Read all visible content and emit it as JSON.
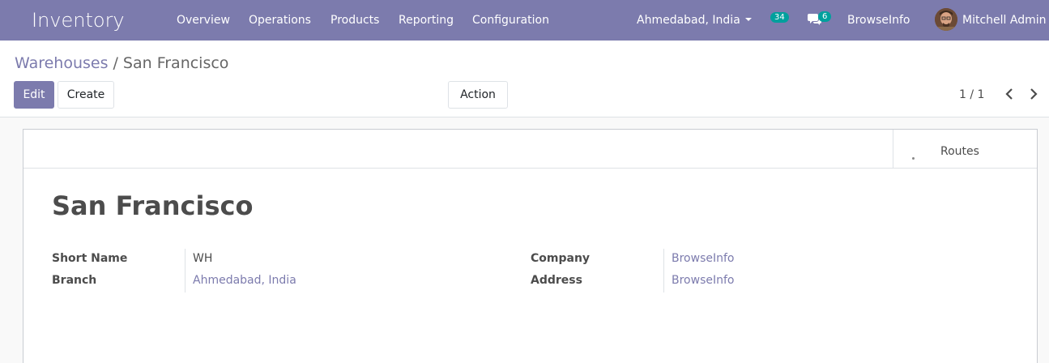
{
  "navbar": {
    "brand": "Inventory",
    "menu": [
      "Overview",
      "Operations",
      "Products",
      "Reporting",
      "Configuration"
    ],
    "branch_selector": "Ahmedabad, India",
    "activity_count": "34",
    "message_count": "6",
    "company": "BrowseInfo",
    "user": "Mitchell Admin"
  },
  "breadcrumb": {
    "parent": "Warehouses",
    "separator": "/",
    "current": "San Francisco"
  },
  "buttons": {
    "edit": "Edit",
    "create": "Create",
    "action": "Action"
  },
  "pager": {
    "value": "1 / 1"
  },
  "stat_buttons": {
    "routes": "Routes"
  },
  "record": {
    "title": "San Francisco",
    "fields": {
      "short_name": {
        "label": "Short Name",
        "value": "WH"
      },
      "branch": {
        "label": "Branch",
        "value": "Ahmedabad, India"
      },
      "company": {
        "label": "Company",
        "value": "BrowseInfo"
      },
      "address": {
        "label": "Address",
        "value": "BrowseInfo"
      }
    }
  },
  "colors": {
    "brand": "#7c7bad",
    "badge": "#00a09d",
    "link": "#7c7bad"
  },
  "icons": [
    "caret-down-icon",
    "chat-icon",
    "chevron-left-icon",
    "chevron-right-icon"
  ]
}
